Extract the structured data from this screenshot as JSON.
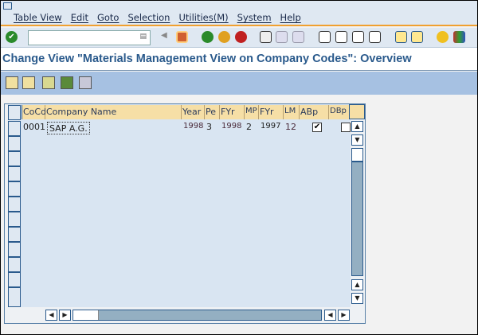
{
  "menu": [
    "Table View",
    "Edit",
    "Goto",
    "Selection",
    "Utilities(M)",
    "System",
    "Help"
  ],
  "command_field": {
    "value": ""
  },
  "title": "Change View \"Materials Management View on Company Codes\": Overview",
  "table": {
    "columns": [
      "CoCd",
      "Company Name",
      "Year",
      "Pe",
      "FYr",
      "MP",
      "FYr",
      "LM",
      "ABp",
      "DBp"
    ],
    "rows": [
      {
        "CoCd": "0001",
        "Company Name": "SAP A.G.",
        "Year": "1998",
        "Pe": "3",
        "FYr": "1998",
        "MP": "2",
        "FYr2": "1997",
        "LM": "12",
        "ABp": true,
        "DBp": false
      }
    ]
  },
  "icons": [
    "enter-icon",
    "back-icon",
    "save-icon",
    "back-green-icon",
    "exit-icon",
    "cancel-icon",
    "print-icon",
    "find-icon",
    "find-next-icon",
    "first-page-icon",
    "prev-page-icon",
    "next-page-icon",
    "last-page-icon",
    "new-session-icon",
    "shortcut-icon",
    "help-icon",
    "customize-icon",
    "change-icon",
    "undo-icon",
    "select-all-icon",
    "select-block-icon",
    "deselect-all-icon",
    "table-settings-icon"
  ]
}
